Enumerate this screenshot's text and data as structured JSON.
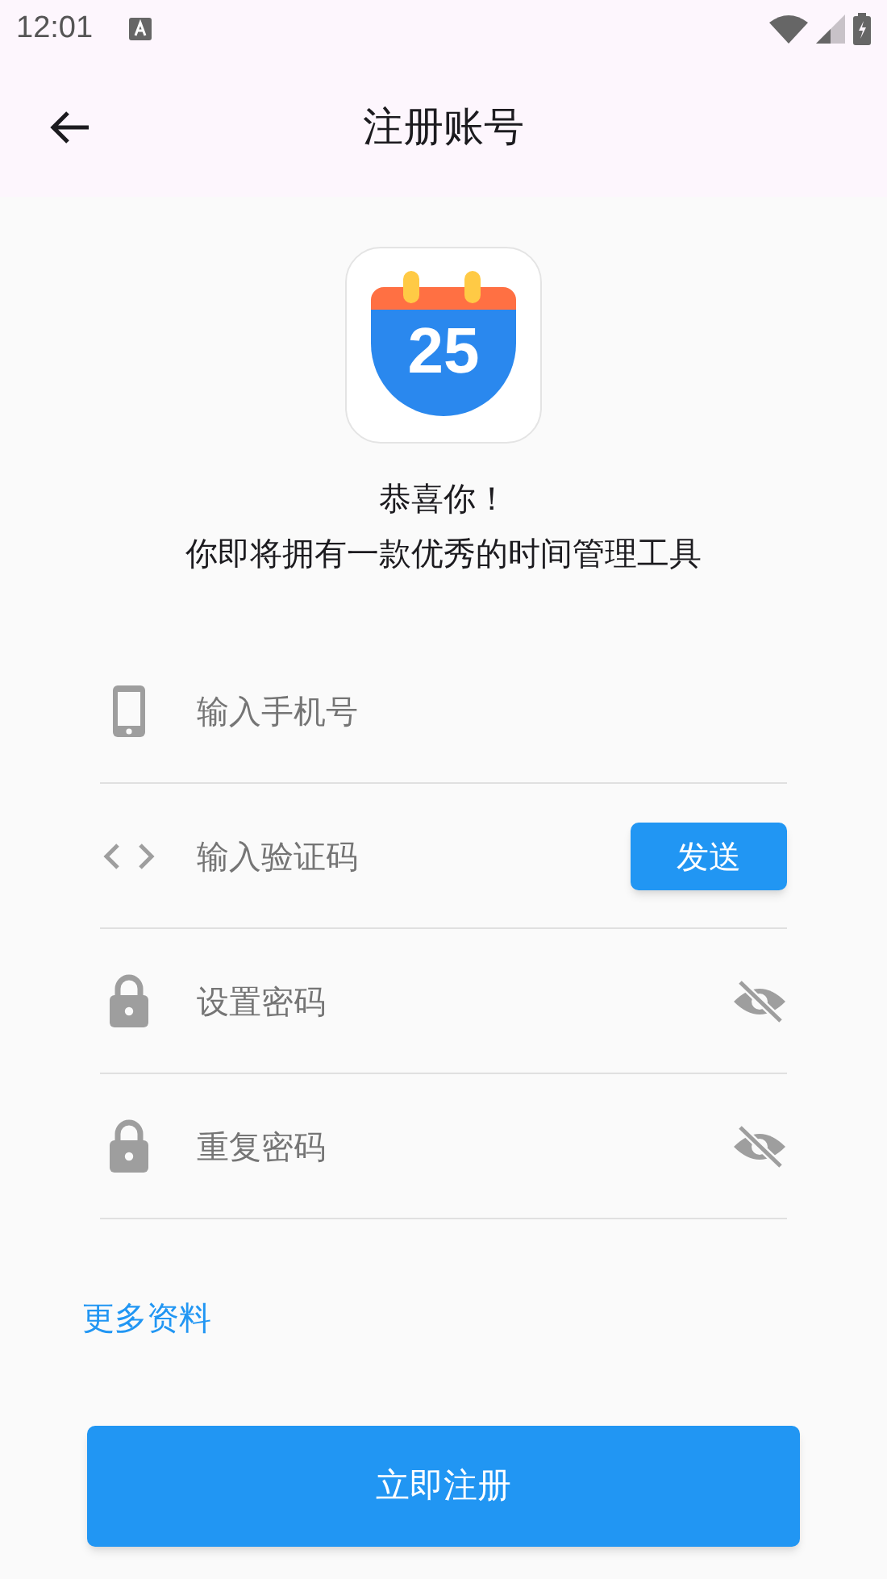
{
  "status_bar": {
    "time": "12:01"
  },
  "app_bar": {
    "title": "注册账号"
  },
  "logo": {
    "day": "25"
  },
  "greeting": {
    "line_1": "恭喜你！",
    "line_2": "你即将拥有一款优秀的时间管理工具"
  },
  "fields": [
    {
      "kind": "phone",
      "placeholder": "输入手机号"
    },
    {
      "kind": "code",
      "placeholder": "输入验证码",
      "button": "发送"
    },
    {
      "kind": "password",
      "placeholder": "设置密码",
      "obscured": true
    },
    {
      "kind": "password",
      "placeholder": "重复密码",
      "obscured": true
    }
  ],
  "more_link": "更多资料",
  "submit_button": "立即注册"
}
